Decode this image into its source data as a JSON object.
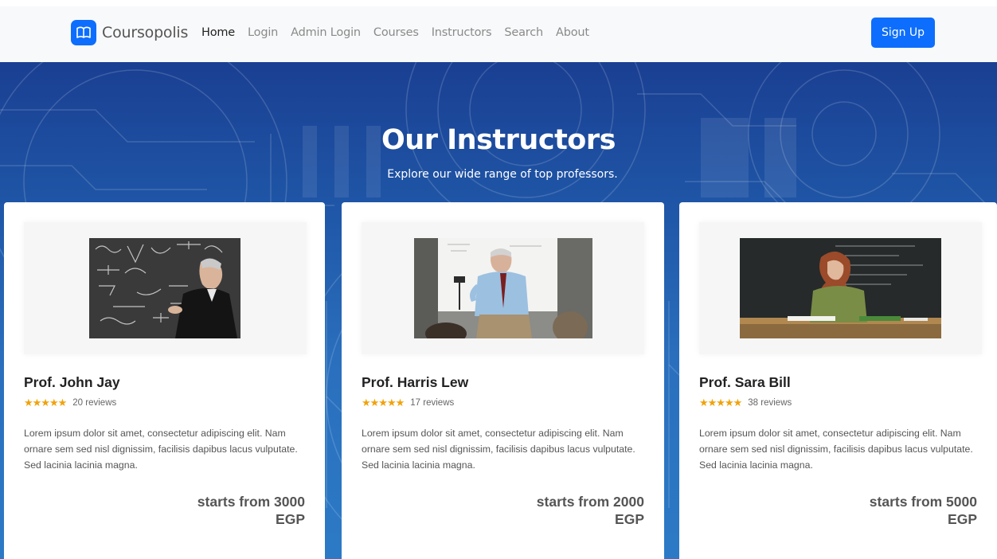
{
  "navbar": {
    "brand": "Coursopolis",
    "brand_icon": "book-icon",
    "links": [
      {
        "label": "Home",
        "active": true
      },
      {
        "label": "Login",
        "active": false
      },
      {
        "label": "Admin Login",
        "active": false
      },
      {
        "label": "Courses",
        "active": false
      },
      {
        "label": "Instructors",
        "active": false
      },
      {
        "label": "Search",
        "active": false
      },
      {
        "label": "About",
        "active": false
      }
    ],
    "signup_label": "Sign Up"
  },
  "hero": {
    "title": "Our Instructors",
    "subtitle": "Explore our wide range of top professors."
  },
  "instructors": [
    {
      "name": "Prof. John Jay",
      "rating": 5,
      "reviews": "20 reviews",
      "description": "Lorem ipsum dolor sit amet, consectetur adipiscing elit. Nam ornare sem sed nisl dignissim, facilisis dapibus lacus vulputate. Sed lacinia lacinia magna.",
      "price_line1": "starts from 3000",
      "price_line2": "EGP"
    },
    {
      "name": "Prof. Harris Lew",
      "rating": 5,
      "reviews": "17 reviews",
      "description": "Lorem ipsum dolor sit amet, consectetur adipiscing elit. Nam ornare sem sed nisl dignissim, facilisis dapibus lacus vulputate. Sed lacinia lacinia magna.",
      "price_line1": "starts from 2000",
      "price_line2": "EGP"
    },
    {
      "name": "Prof. Sara Bill",
      "rating": 5,
      "reviews": "38 reviews",
      "description": "Lorem ipsum dolor sit amet, consectetur adipiscing elit. Nam ornare sem sed nisl dignissim, facilisis dapibus lacus vulputate. Sed lacinia lacinia magna.",
      "price_line1": "starts from 5000",
      "price_line2": "EGP"
    }
  ],
  "colors": {
    "primary": "#0d6efd",
    "star": "#f0a30a",
    "hero_dark": "#1a3f92",
    "hero_light": "#2c7ac6"
  }
}
